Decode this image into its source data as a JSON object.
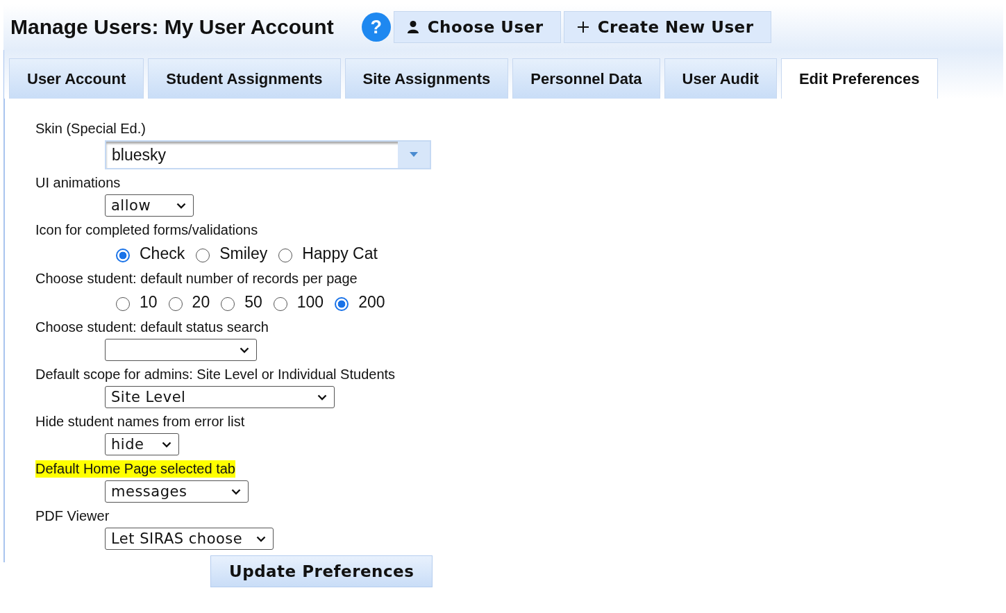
{
  "header": {
    "title": "Manage Users: My User Account",
    "help": "?",
    "buttons": [
      {
        "kind": "user",
        "label": "Choose User"
      },
      {
        "kind": "plus",
        "label": "Create New User"
      }
    ]
  },
  "tabs": [
    {
      "label": "User Account",
      "selected": false
    },
    {
      "label": "Student Assignments",
      "selected": false
    },
    {
      "label": "Site Assignments",
      "selected": false
    },
    {
      "label": "Personnel Data",
      "selected": false
    },
    {
      "label": "User Audit",
      "selected": false
    },
    {
      "label": "Edit Preferences",
      "selected": true
    }
  ],
  "fields": [
    {
      "kind": "combobox",
      "label": "Skin (Special Ed.)",
      "highlighted": false,
      "value": "bluesky"
    },
    {
      "kind": "select",
      "label": "UI animations",
      "highlighted": false,
      "value": "allow"
    },
    {
      "kind": "radio",
      "label": "Icon for completed forms/validations",
      "highlighted": false,
      "options": [
        {
          "label": "Check",
          "selected": true
        },
        {
          "label": "Smiley",
          "selected": false
        },
        {
          "label": "Happy Cat",
          "selected": false
        }
      ]
    },
    {
      "kind": "radio",
      "label": "Choose student: default number of records per page",
      "highlighted": false,
      "options": [
        {
          "label": "10",
          "selected": false
        },
        {
          "label": "20",
          "selected": false
        },
        {
          "label": "50",
          "selected": false
        },
        {
          "label": "100",
          "selected": false
        },
        {
          "label": "200",
          "selected": true
        }
      ]
    },
    {
      "kind": "select",
      "label": "Choose student: default status search",
      "highlighted": false
    },
    {
      "kind": "select",
      "label": "Default scope for admins: Site Level or Individual Students",
      "highlighted": false,
      "value": "Site Level"
    },
    {
      "kind": "select",
      "label": "Hide student names from error list",
      "highlighted": false,
      "value": "hide"
    },
    {
      "kind": "select",
      "label": "Default Home Page selected tab",
      "highlighted": true,
      "value": "messages"
    },
    {
      "kind": "select",
      "label": "PDF Viewer",
      "highlighted": false,
      "value": "Let SIRAS choose"
    }
  ],
  "submit": "Update Preferences"
}
